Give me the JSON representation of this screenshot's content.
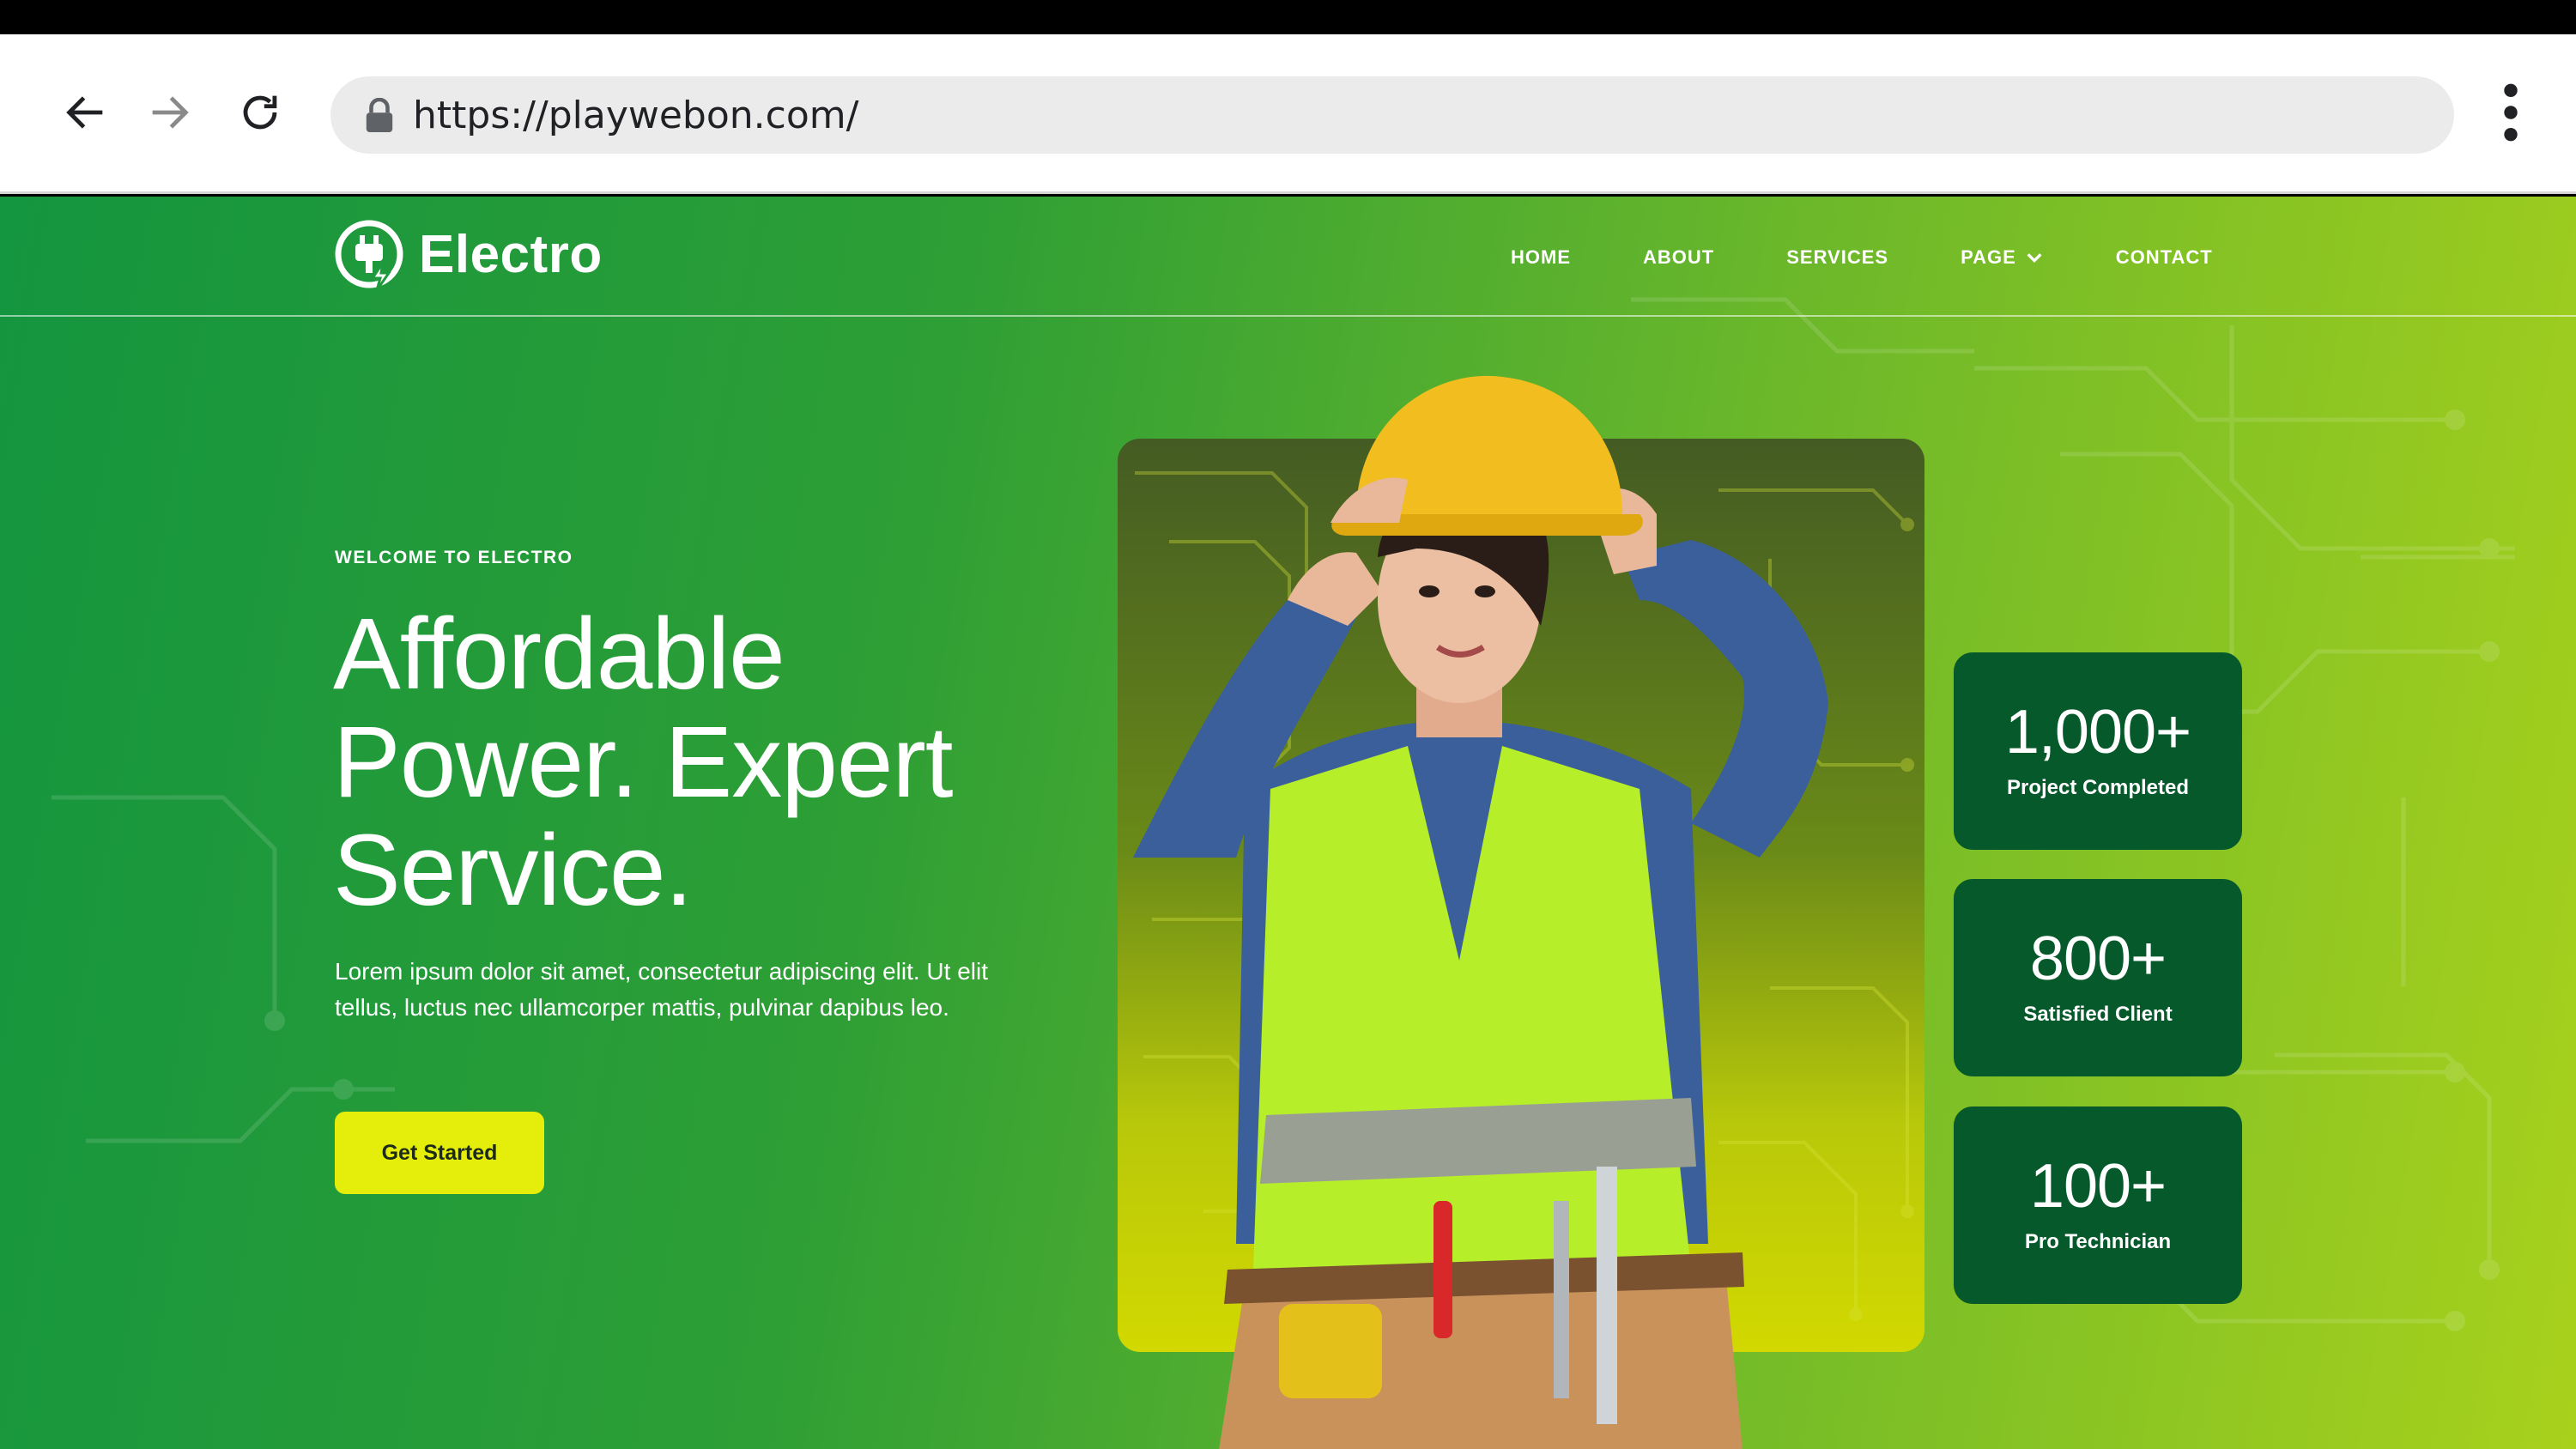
{
  "browser": {
    "url": "https://playwebon.com/",
    "icons": [
      "back-arrow-icon",
      "forward-arrow-icon",
      "reload-icon",
      "lock-icon",
      "more-vert-icon"
    ]
  },
  "site": {
    "brand": "Electro",
    "nav": [
      {
        "label": "HOME"
      },
      {
        "label": "ABOUT"
      },
      {
        "label": "SERVICES"
      },
      {
        "label": "PAGE"
      },
      {
        "label": "CONTACT"
      }
    ]
  },
  "hero": {
    "eyebrow": "WELCOME TO ELECTRO",
    "headline_line1": "Affordable",
    "headline_line2": "Power. Expert",
    "headline_line3": "Service.",
    "intro": "Lorem ipsum dolor sit amet, consectetur adipiscing elit. Ut elit tellus, luctus nec ullamcorper mattis, pulvinar dapibus leo.",
    "cta_label": "Get Started"
  },
  "stats": [
    {
      "value": "1,000+",
      "label": "Project Completed"
    },
    {
      "value": "800+",
      "label": "Satisfied Client"
    },
    {
      "value": "100+",
      "label": "Pro Technician"
    }
  ],
  "colors": {
    "gradient_start": "#14953f",
    "gradient_end": "#a8d11c",
    "stat_card": "#06592b",
    "cta": "#e5ee0a"
  }
}
